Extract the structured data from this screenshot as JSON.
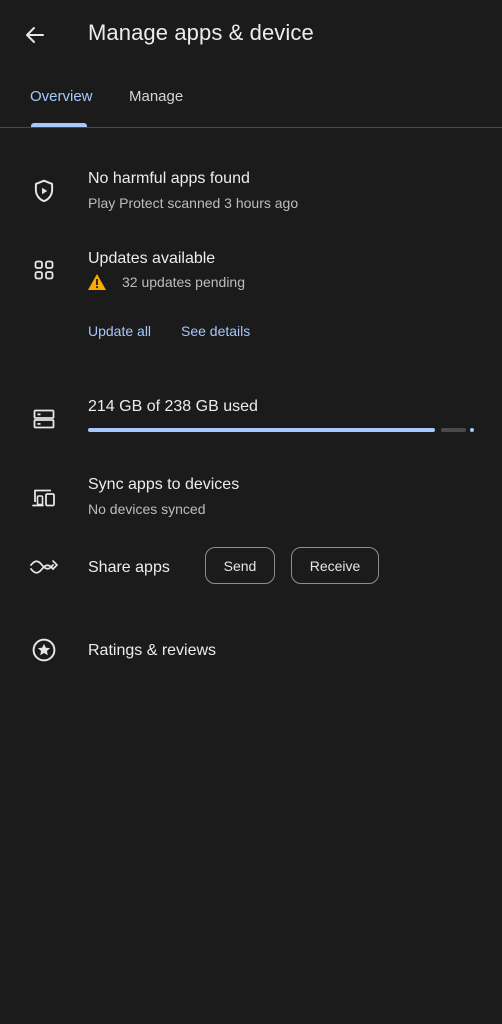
{
  "header": {
    "title": "Manage apps & device",
    "back_icon": "arrow-back-icon"
  },
  "tabs": [
    {
      "label": "Overview",
      "active": true
    },
    {
      "label": "Manage",
      "active": false
    }
  ],
  "protect": {
    "icon": "shield-play-icon",
    "title": "No harmful apps found",
    "subtitle": "Play Protect scanned 3 hours ago"
  },
  "updates": {
    "icon": "apps-grid-icon",
    "title": "Updates available",
    "warning_icon": "warning-icon",
    "pending_text": "32 updates pending",
    "update_all_label": "Update all",
    "see_details_label": "See details"
  },
  "storage": {
    "icon": "storage-icon",
    "used_text": "214 GB of 238 GB used",
    "used_fraction": 0.899
  },
  "sync": {
    "icon": "devices-icon",
    "title": "Sync apps to devices",
    "subtitle": "No devices synced"
  },
  "share": {
    "icon": "share-apps-icon",
    "title": "Share apps",
    "send_label": "Send",
    "receive_label": "Receive"
  },
  "ratings": {
    "icon": "star-circle-icon",
    "title": "Ratings & reviews"
  },
  "colors": {
    "background": "#1b1b1b",
    "accent": "#a8c7fa",
    "warning": "#f9ab00"
  }
}
